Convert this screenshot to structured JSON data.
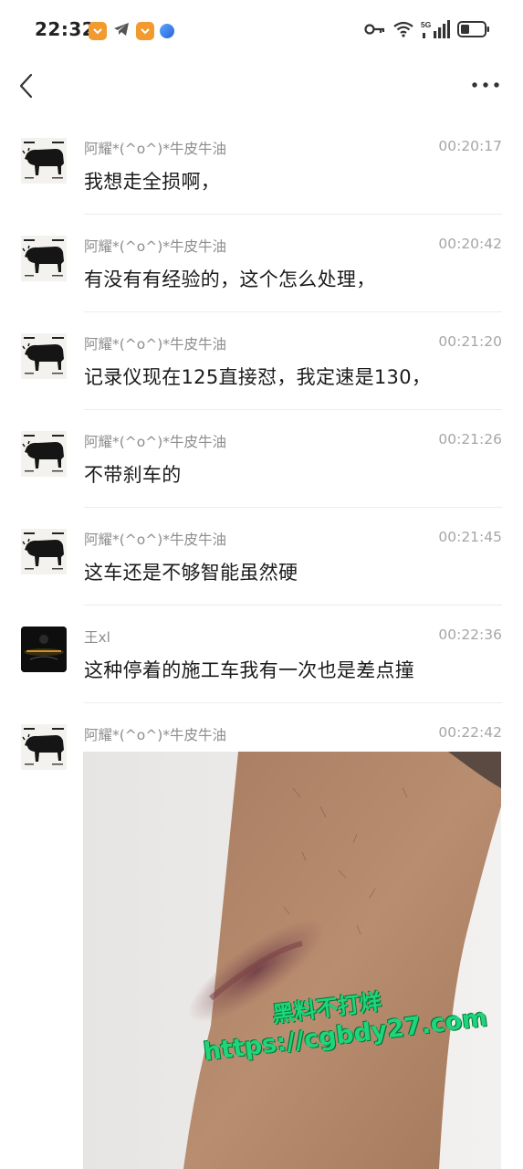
{
  "status_bar": {
    "time": "22:32",
    "network_label": "5G",
    "icons": [
      "app-badge-icon",
      "app-badge-icon",
      "telegram-icon",
      "blue-circle-icon",
      "key-icon",
      "wifi-icon",
      "signal-icon",
      "battery-icon"
    ]
  },
  "header": {
    "back_icon": "chevron-left-icon",
    "more_icon": "more-horizontal-icon"
  },
  "messages": [
    {
      "sender": "阿耀*(^o^)*牛皮牛油",
      "time": "00:20:17",
      "text": "我想走全损啊，"
    },
    {
      "sender": "阿耀*(^o^)*牛皮牛油",
      "time": "00:20:42",
      "text": "有没有有经验的，这个怎么处理，"
    },
    {
      "sender": "阿耀*(^o^)*牛皮牛油",
      "time": "00:21:20",
      "text": "记录仪现在125直接怼，我定速是130，"
    },
    {
      "sender": "阿耀*(^o^)*牛皮牛油",
      "time": "00:21:26",
      "text": "不带刹车的"
    },
    {
      "sender": "阿耀*(^o^)*牛皮牛油",
      "time": "00:21:45",
      "text": "这车还是不够智能虽然硬"
    },
    {
      "sender": "王xl",
      "time": "00:22:36",
      "text": "这种停着的施工车我有一次也是差点撞"
    },
    {
      "sender": "阿耀*(^o^)*牛皮牛油",
      "time": "00:22:42"
    }
  ],
  "photo": {
    "watermark_line1": "黑料不打烊",
    "watermark_line2": "https://cgbdy27.com"
  }
}
